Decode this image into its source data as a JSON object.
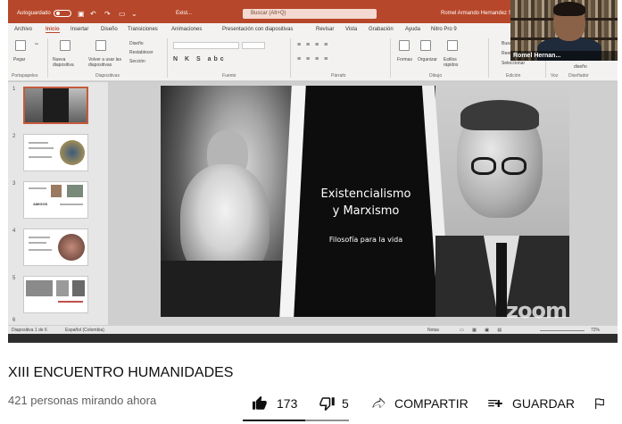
{
  "powerpoint": {
    "titlebar": {
      "autosave_label": "Autoguardado",
      "file_name": "Exist...",
      "search_placeholder": "Buscar (Alt+Q)",
      "user_name": "Romel Armando Hernandez Silva"
    },
    "ribbon_tabs": [
      "Archivo",
      "Inicio",
      "Insertar",
      "Diseño",
      "Transiciones",
      "Animaciones",
      "Presentación con diapositivas",
      "Revisar",
      "Vista",
      "Grabación",
      "Ayuda",
      "Nitro Pro 9"
    ],
    "active_tab_index": 1,
    "ribbon": {
      "paste_label": "Pegar",
      "new_slide_label": "Nueva diapositiva",
      "reuse_slides_label": "Volver a usar las diapositivas",
      "layout_label": "Diseño",
      "reset_label": "Restablecer",
      "section_label": "Sección",
      "shapes_label": "Formas",
      "arrange_label": "Organizar",
      "quick_styles_label": "Estilos rápidos",
      "search_label": "Buscar",
      "replace_label": "Reem",
      "select_label": "Seleccionar",
      "designer_label": "diseño",
      "groups": {
        "clipboard": "Portapapeles",
        "slides": "Diapositivas",
        "font": "Fuente",
        "paragraph": "Párrafo",
        "drawing": "Dibujo",
        "editing": "Edición",
        "voice": "Voz",
        "designer": "Diseñador"
      }
    },
    "thumbnail_numbers": [
      "1",
      "2",
      "3",
      "4",
      "5",
      "6"
    ],
    "thumbnail_3_text": "AMIGOS",
    "slide": {
      "title_line1": "Existencialismo",
      "title_line2": "y Marxismo",
      "subtitle": "Filosofía para la vida"
    },
    "statusbar": {
      "slide_counter": "Diapositiva 1 de 6",
      "language": "Español (Colombia)",
      "notes_label": "Notas",
      "zoom_level": "72%"
    },
    "zoom_watermark": "zoom",
    "webcam_name": "Romel Hernan..."
  },
  "youtube": {
    "title": "XIII ENCUENTRO HUMANIDADES",
    "viewers": "421 personas mirando ahora",
    "likes": "173",
    "dislikes": "5",
    "share_label": "COMPARTIR",
    "save_label": "GUARDAR"
  },
  "colors": {
    "powerpoint_accent": "#b7472a",
    "text_primary": "#0f0f0f",
    "text_secondary": "#606060"
  },
  "icons": [
    "like-icon",
    "dislike-icon",
    "share-icon",
    "save-playlist-icon",
    "report-flag-icon"
  ]
}
